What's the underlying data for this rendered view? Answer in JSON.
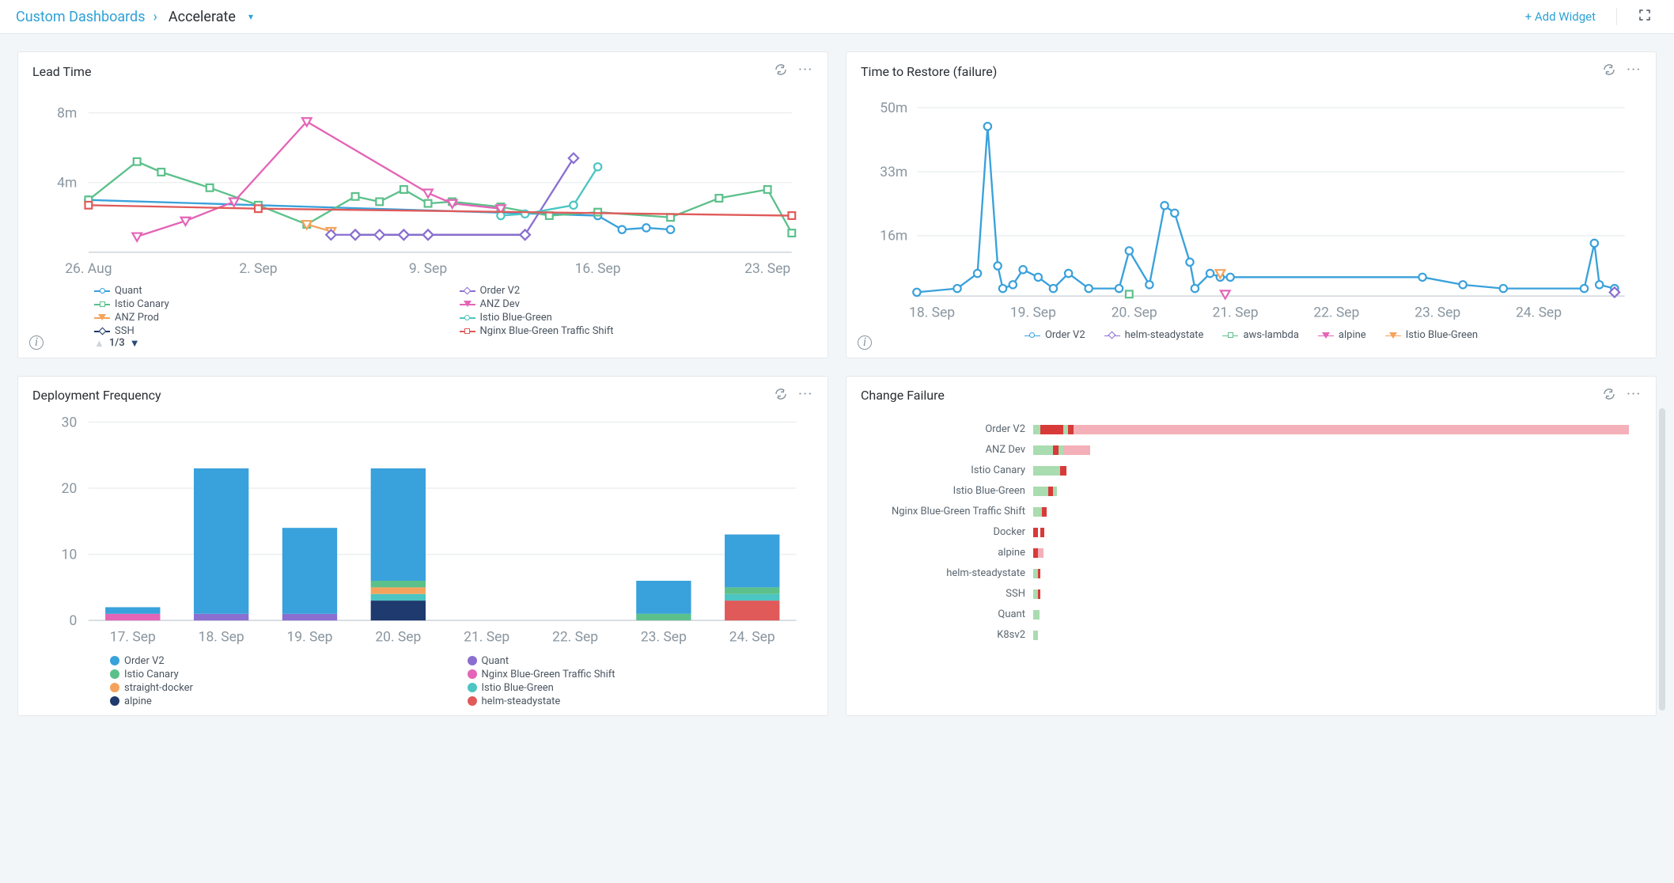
{
  "breadcrumb": {
    "root": "Custom Dashboards",
    "sep": "›",
    "title": "Accelerate"
  },
  "header": {
    "add_widget": "+ Add Widget"
  },
  "pager": {
    "text": "1/3"
  },
  "colors": {
    "blue": "#39a1db",
    "green": "#5cc08b",
    "orange": "#f5a35c",
    "navy": "#1e3a6e",
    "purple": "#8a6fd1",
    "magenta": "#e464b7",
    "teal": "#4cc5c3",
    "red": "#e05a5a",
    "pink_light": "#f4b0b8",
    "green_light": "#a9dcb0",
    "red_strong": "#d83a3a"
  },
  "widgets": {
    "lead": {
      "title": "Lead Time",
      "legend": [
        {
          "label": "Quant",
          "color": "#39a1db",
          "marker": "circle"
        },
        {
          "label": "Order V2",
          "color": "#8a6fd1",
          "marker": "diamond"
        },
        {
          "label": "Istio Canary",
          "color": "#5cc08b",
          "marker": "square"
        },
        {
          "label": "ANZ Dev",
          "color": "#e464b7",
          "marker": "tri-down"
        },
        {
          "label": "ANZ Prod",
          "color": "#f5a35c",
          "marker": "tri-down"
        },
        {
          "label": "Istio Blue-Green",
          "color": "#4cc5c3",
          "marker": "circle"
        },
        {
          "label": "SSH",
          "color": "#1e3a6e",
          "marker": "diamond"
        },
        {
          "label": "Nginx Blue-Green Traffic Shift",
          "color": "#e05a5a",
          "marker": "square"
        }
      ]
    },
    "restore": {
      "title": "Time to Restore (failure)",
      "legend": [
        {
          "label": "Order V2",
          "color": "#39a1db",
          "marker": "circle"
        },
        {
          "label": "helm-steadystate",
          "color": "#8a6fd1",
          "marker": "diamond"
        },
        {
          "label": "aws-lambda",
          "color": "#5cc08b",
          "marker": "square"
        },
        {
          "label": "alpine",
          "color": "#e464b7",
          "marker": "tri-down"
        },
        {
          "label": "Istio Blue-Green",
          "color": "#f5a35c",
          "marker": "tri-down"
        }
      ]
    },
    "deploy": {
      "title": "Deployment Frequency",
      "legend": [
        {
          "label": "Order V2",
          "color": "#39a1db"
        },
        {
          "label": "Quant",
          "color": "#8a6fd1"
        },
        {
          "label": "Istio Canary",
          "color": "#5cc08b"
        },
        {
          "label": "Nginx Blue-Green Traffic Shift",
          "color": "#e464b7"
        },
        {
          "label": "straight-docker",
          "color": "#f5a35c"
        },
        {
          "label": "Istio Blue-Green",
          "color": "#4cc5c3"
        },
        {
          "label": "alpine",
          "color": "#1e3a6e"
        },
        {
          "label": "helm-steadystate",
          "color": "#e05a5a"
        }
      ]
    },
    "failure": {
      "title": "Change Failure"
    }
  },
  "chart_data": [
    {
      "id": "lead_time",
      "type": "line",
      "title": "Lead Time",
      "xlabel": "",
      "ylabel": "",
      "y_ticks": [
        "4m",
        "8m"
      ],
      "x_ticks": [
        "26. Aug",
        "2. Sep",
        "9. Sep",
        "16. Sep",
        "23. Sep"
      ],
      "ylim": [
        0,
        9
      ],
      "x_index": [
        0,
        1,
        2,
        3,
        4,
        5,
        6,
        7,
        8,
        9,
        10,
        11,
        12,
        13,
        14,
        15,
        16,
        17,
        18,
        19,
        20,
        21,
        22,
        23,
        24,
        25,
        26,
        27,
        28,
        29
      ],
      "series": [
        {
          "name": "Quant",
          "color": "#39a1db",
          "marker": "circle",
          "x": [
            0,
            21,
            22,
            23,
            24
          ],
          "y": [
            3.0,
            2.1,
            1.3,
            1.4,
            1.3
          ]
        },
        {
          "name": "Istio Canary",
          "color": "#5cc08b",
          "marker": "square",
          "x": [
            0,
            2,
            3,
            5,
            7,
            9,
            11,
            12,
            13,
            14,
            15,
            17,
            19,
            21,
            24,
            26,
            28,
            29
          ],
          "y": [
            3.0,
            5.2,
            4.6,
            3.7,
            2.7,
            1.6,
            3.2,
            2.9,
            3.6,
            2.8,
            2.9,
            2.6,
            2.1,
            2.3,
            2.0,
            3.1,
            3.6,
            1.1
          ]
        },
        {
          "name": "ANZ Prod",
          "color": "#f5a35c",
          "marker": "tri-down",
          "x": [
            9,
            10
          ],
          "y": [
            1.6,
            1.2
          ]
        },
        {
          "name": "SSH",
          "color": "#1e3a6e",
          "marker": "diamond",
          "x": [
            11,
            13,
            14,
            18
          ],
          "y": [
            1.0,
            1.0,
            1.0,
            1.0
          ]
        },
        {
          "name": "Order V2",
          "color": "#8a6fd1",
          "marker": "diamond",
          "x": [
            10,
            11,
            12,
            13,
            14,
            18,
            20
          ],
          "y": [
            1.0,
            1.0,
            1.0,
            1.0,
            1.0,
            1.0,
            5.4
          ]
        },
        {
          "name": "ANZ Dev",
          "color": "#e464b7",
          "marker": "tri-down",
          "x": [
            2,
            4,
            6,
            9,
            14,
            15,
            17
          ],
          "y": [
            0.9,
            1.8,
            2.9,
            7.5,
            3.4,
            2.8,
            2.5
          ]
        },
        {
          "name": "Istio Blue-Green",
          "color": "#4cc5c3",
          "marker": "circle",
          "x": [
            17,
            18,
            20,
            21
          ],
          "y": [
            2.1,
            2.2,
            2.7,
            4.9
          ]
        },
        {
          "name": "Nginx Blue-Green Traffic Shift",
          "color": "#e05a5a",
          "marker": "square",
          "x": [
            0,
            7,
            29
          ],
          "y": [
            2.7,
            2.5,
            2.1
          ]
        }
      ]
    },
    {
      "id": "time_to_restore",
      "type": "line",
      "title": "Time to Restore (failure)",
      "y_ticks": [
        "16m",
        "33m",
        "50m"
      ],
      "x_ticks": [
        "18. Sep",
        "19. Sep",
        "20. Sep",
        "21. Sep",
        "22. Sep",
        "23. Sep",
        "24. Sep"
      ],
      "ylim": [
        0,
        52
      ],
      "series": [
        {
          "name": "Order V2",
          "color": "#39a1db",
          "marker": "circle",
          "x": [
            0,
            0.4,
            0.6,
            0.7,
            0.8,
            0.85,
            0.95,
            1.05,
            1.2,
            1.35,
            1.5,
            1.7,
            2.0,
            2.1,
            2.3,
            2.45,
            2.55,
            2.7,
            2.75,
            2.9,
            3.0,
            3.1,
            5.0,
            5.4,
            5.8,
            6.6,
            6.7,
            6.75,
            6.9
          ],
          "y": [
            1,
            2,
            6,
            45,
            8,
            2,
            3,
            7,
            5,
            2,
            6,
            2,
            2,
            12,
            3,
            24,
            22,
            9,
            2,
            6,
            5,
            5,
            5,
            3,
            2,
            2,
            14,
            3,
            2
          ]
        },
        {
          "name": "helm-steadystate",
          "color": "#8a6fd1",
          "marker": "diamond",
          "x": [
            6.9
          ],
          "y": [
            1
          ]
        },
        {
          "name": "aws-lambda",
          "color": "#5cc08b",
          "marker": "square",
          "x": [
            2.1
          ],
          "y": [
            0.5
          ]
        },
        {
          "name": "alpine",
          "color": "#e464b7",
          "marker": "tri-down",
          "x": [
            3.05
          ],
          "y": [
            0.5
          ]
        },
        {
          "name": "Istio Blue-Green",
          "color": "#f5a35c",
          "marker": "tri-down",
          "x": [
            3.0
          ],
          "y": [
            6
          ]
        }
      ]
    },
    {
      "id": "deployment_frequency",
      "type": "bar",
      "title": "Deployment Frequency",
      "y_ticks": [
        0,
        10,
        20,
        30
      ],
      "ylim": [
        0,
        30
      ],
      "categories": [
        "17. Sep",
        "18. Sep",
        "19. Sep",
        "20. Sep",
        "21. Sep",
        "22. Sep",
        "23. Sep",
        "24. Sep"
      ],
      "series": [
        {
          "name": "Order V2",
          "color": "#39a1db",
          "values": [
            1,
            22,
            13,
            17,
            0,
            0,
            5,
            8
          ]
        },
        {
          "name": "Quant",
          "color": "#8a6fd1",
          "values": [
            0,
            1,
            1,
            0,
            0,
            0,
            0,
            0
          ]
        },
        {
          "name": "Istio Canary",
          "color": "#5cc08b",
          "values": [
            0,
            0,
            0,
            1,
            0,
            0,
            1,
            1
          ]
        },
        {
          "name": "Nginx Blue-Green Traffic Shift",
          "color": "#e464b7",
          "values": [
            1,
            0,
            0,
            0,
            0,
            0,
            0,
            0
          ]
        },
        {
          "name": "straight-docker",
          "color": "#f5a35c",
          "values": [
            0,
            0,
            0,
            1,
            0,
            0,
            0,
            0
          ]
        },
        {
          "name": "Istio Blue-Green",
          "color": "#4cc5c3",
          "values": [
            0,
            0,
            0,
            1,
            0,
            0,
            0,
            1
          ]
        },
        {
          "name": "alpine",
          "color": "#1e3a6e",
          "values": [
            0,
            0,
            0,
            3,
            0,
            0,
            0,
            0
          ]
        },
        {
          "name": "helm-steadystate",
          "color": "#e05a5a",
          "values": [
            0,
            0,
            0,
            0,
            0,
            0,
            0,
            3
          ]
        }
      ]
    },
    {
      "id": "change_failure",
      "type": "bar",
      "orientation": "horizontal",
      "title": "Change Failure",
      "max": 40,
      "categories": [
        "Order V2",
        "ANZ Dev",
        "Istio Canary",
        "Istio Blue-Green",
        "Nginx Blue-Green Traffic Shift",
        "Docker",
        "alpine",
        "helm-steadystate",
        "SSH",
        "Quant",
        "K8sv2"
      ],
      "series": [
        {
          "name": "success",
          "color": "#a9dcb0"
        },
        {
          "name": "fail",
          "color": "#d83a3a"
        },
        {
          "name": "partial",
          "color": "#f4b0b8"
        }
      ],
      "rows": [
        {
          "label": "Order V2",
          "segments": [
            [
              "#a9dcb0",
              0.5
            ],
            [
              "#d83a3a",
              1.5
            ],
            [
              "#a9dcb0",
              0.3
            ],
            [
              "#d83a3a",
              0.4
            ],
            [
              "#f4b0b8",
              37
            ]
          ]
        },
        {
          "label": "ANZ Dev",
          "segments": [
            [
              "#a9dcb0",
              1.3
            ],
            [
              "#d83a3a",
              0.4
            ],
            [
              "#a9dcb0",
              0.3
            ],
            [
              "#f4b0b8",
              1.8
            ]
          ]
        },
        {
          "label": "Istio Canary",
          "segments": [
            [
              "#a9dcb0",
              1.8
            ],
            [
              "#d83a3a",
              0.4
            ]
          ]
        },
        {
          "label": "Istio Blue-Green",
          "segments": [
            [
              "#a9dcb0",
              1.0
            ],
            [
              "#d83a3a",
              0.3
            ],
            [
              "#a9dcb0",
              0.3
            ]
          ]
        },
        {
          "label": "Nginx Blue-Green Traffic Shift",
          "segments": [
            [
              "#a9dcb0",
              0.6
            ],
            [
              "#d83a3a",
              0.3
            ]
          ]
        },
        {
          "label": "Docker",
          "segments": [
            [
              "#d83a3a",
              0.3
            ],
            [
              "#ffffff00",
              0.15
            ],
            [
              "#d83a3a",
              0.3
            ]
          ]
        },
        {
          "label": "alpine",
          "segments": [
            [
              "#d83a3a",
              0.3
            ],
            [
              "#f4b0b8",
              0.4
            ]
          ]
        },
        {
          "label": "helm-steadystate",
          "segments": [
            [
              "#a9dcb0",
              0.3
            ],
            [
              "#d83a3a",
              0.2
            ]
          ]
        },
        {
          "label": "SSH",
          "segments": [
            [
              "#a9dcb0",
              0.3
            ],
            [
              "#d83a3a",
              0.15
            ]
          ]
        },
        {
          "label": "Quant",
          "segments": [
            [
              "#a9dcb0",
              0.4
            ]
          ]
        },
        {
          "label": "K8sv2",
          "segments": [
            [
              "#a9dcb0",
              0.3
            ]
          ]
        }
      ]
    }
  ]
}
